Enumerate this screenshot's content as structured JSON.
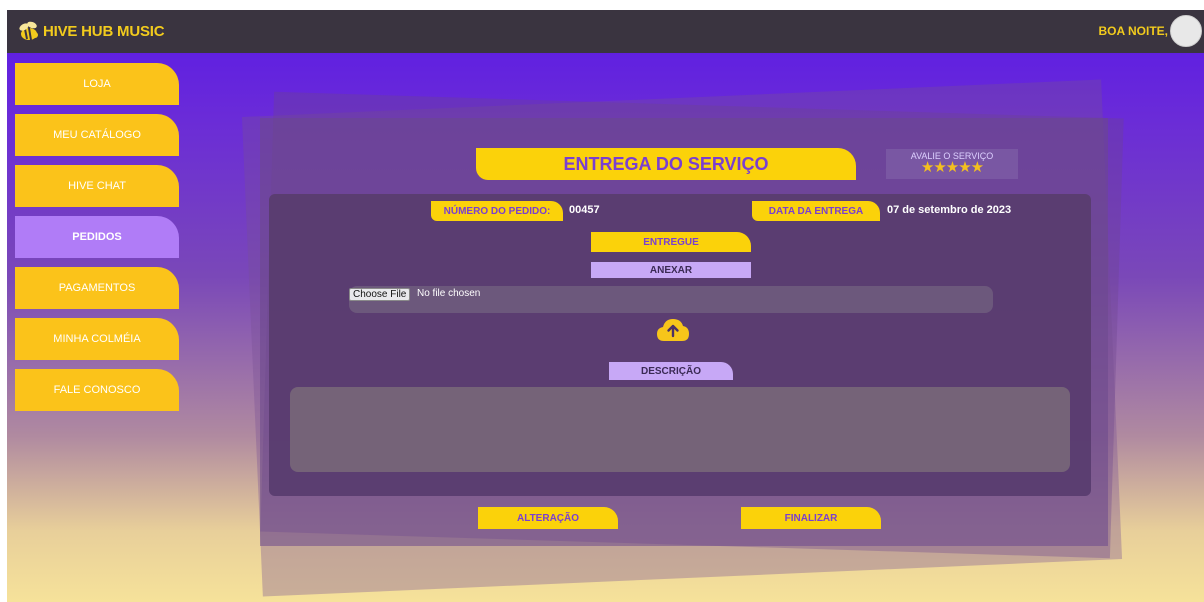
{
  "brand": {
    "name": "HIVE HUB MUSIC",
    "icon": "bee-icon"
  },
  "header": {
    "greeting": "BOA NOITE,"
  },
  "sidebar": {
    "items": [
      {
        "label": "LOJA"
      },
      {
        "label": "MEU CATÁLOGO"
      },
      {
        "label": "HIVE CHAT"
      },
      {
        "label": "PEDIDOS",
        "active": true
      },
      {
        "label": "PAGAMENTOS"
      },
      {
        "label": "MINHA COLMÉIA"
      },
      {
        "label": "FALE CONOSCO"
      }
    ]
  },
  "main": {
    "title": "ENTREGA DO SERVIÇO",
    "rating": {
      "label": "AVALIE O SERVIÇO",
      "stars": "★★★★★"
    },
    "order_number_label": "NÚMERO DO PEDIDO:",
    "order_number": "00457",
    "delivery_date_label": "DATA DA ENTREGA",
    "delivery_date": "07 de setembro de 2023",
    "status": "ENTREGUE",
    "attach_label": "ANEXAR",
    "file_button": "Choose File",
    "file_status": "No file chosen",
    "description_label": "DESCRIÇÃO",
    "description_value": "",
    "buttons": {
      "change": "ALTERAÇÃO",
      "finish": "FINALIZAR"
    }
  },
  "colors": {
    "accent_yellow": "#fbd20a",
    "accent_purple": "#7a3fd0",
    "active_item": "#b07cf7",
    "topbar": "#3a3440"
  }
}
